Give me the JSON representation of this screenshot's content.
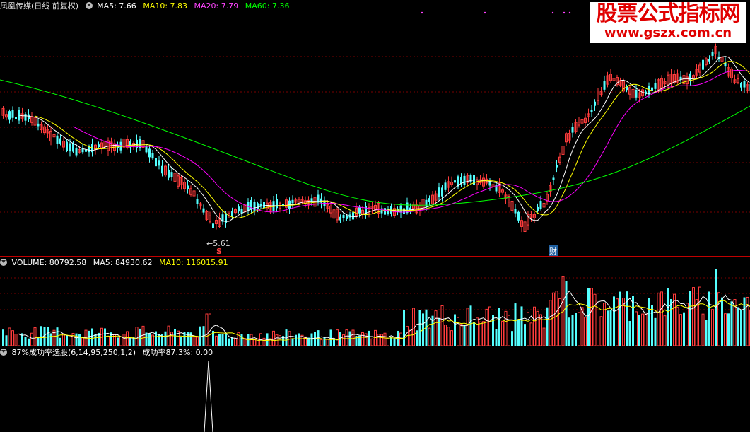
{
  "price_panel": {
    "stock_name": "凤凰传媒(日线 前复权)",
    "ma5_label": "MA5: 7.66",
    "ma10_label": "MA10: 7.83",
    "ma20_label": "MA20: 7.79",
    "ma60_label": "MA60: 7.36",
    "low_marker": "5.61",
    "signal_s": "S",
    "signal_cai": "财"
  },
  "volume_panel": {
    "volume_label": "VOLUME: 80792.58",
    "ma5_label": "MA5: 84930.62",
    "ma10_label": "MA10: 116015.91"
  },
  "indicator_panel": {
    "formula_label": "87%成功率选股(6,14,95,250,1,2)",
    "value_label": "成功率87.3%: 0.00"
  },
  "watermark": {
    "line1": "股票公式指标网",
    "line2": "www.gszx.com.cn"
  },
  "colors": {
    "up": "#ff3c3c",
    "down": "#54ffff",
    "ma5": "#ffffff",
    "ma10": "#ffff00",
    "ma20": "#ff00ff",
    "ma60": "#00ff00",
    "grid": "#7a0000"
  }
}
